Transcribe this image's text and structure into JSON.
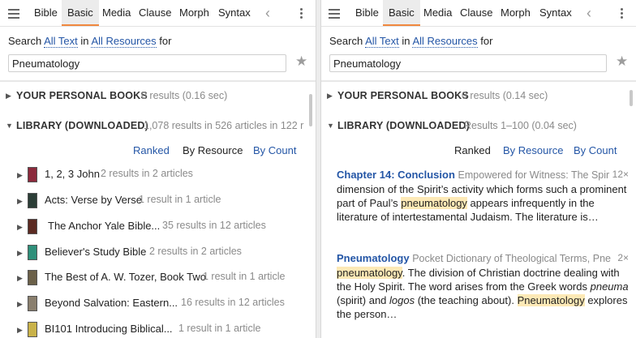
{
  "tabs": [
    "Bible",
    "Basic",
    "Media",
    "Clause",
    "Morph",
    "Syntax"
  ],
  "search_prefix": "Search",
  "search_scope": "All Text",
  "search_in": "in",
  "search_resources": "All Resources",
  "search_for": "for",
  "query": "Pneumatology",
  "left": {
    "personal": {
      "title": "YOUR PERSONAL BOOKS",
      "meta": "0 results (0.16 sec)"
    },
    "library": {
      "title": "LIBRARY (DOWNLOADED)",
      "meta": "1,078 results in 526 articles in 122 r"
    },
    "sort": {
      "ranked": "Ranked",
      "by_resource": "By Resource",
      "by_count": "By Count"
    },
    "books": [
      {
        "title": "1, 2, 3 John",
        "meta": "2 results in 2 articles",
        "cover": "#8b2a3c"
      },
      {
        "title": "Acts: Verse by Verse",
        "meta": "1 result in 1 article",
        "cover": "#2b3d36"
      },
      {
        "title": "The Anchor Yale Bible...",
        "meta": "35 results in 12 articles",
        "cover": "#5b2a22"
      },
      {
        "title": "Believer's Study Bible",
        "meta": "2 results in 2 articles",
        "cover": "#2f8f7a"
      },
      {
        "title": "The Best of A. W. Tozer, Book Two",
        "meta": "1 result in 1 article",
        "cover": "#6b6049"
      },
      {
        "title": "Beyond Salvation: Eastern...",
        "meta": "16 results in 12 articles",
        "cover": "#8a7f6e"
      },
      {
        "title": "BI101 Introducing Biblical...",
        "meta": "1 result in 1 article",
        "cover": "#c9b24a"
      }
    ]
  },
  "right": {
    "personal": {
      "title": "YOUR PERSONAL BOOKS",
      "meta": "0 results (0.14 sec)"
    },
    "library": {
      "title": "LIBRARY (DOWNLOADED)",
      "meta": "Results 1–100 (0.04 sec)"
    },
    "sort": {
      "ranked": "Ranked",
      "by_resource": "By Resource",
      "by_count": "By Count"
    },
    "results": [
      {
        "title": "Chapter 14: Conclusion",
        "source": "Empowered for Witness: The Spir",
        "count": "12×",
        "p1": "dimension of the Spirit’s activity which forms such a prominent part of Paul’s ",
        "hl1": "pneumatology",
        "p2": " appears infrequently in the literature of intertestamental Judaism. The literature is…"
      },
      {
        "title": "Pneumatology",
        "source": "Pocket Dictionary of Theological Terms, Pne",
        "count": "2×",
        "hl1": "pneumatology",
        "p1": ". The division of Christian doctrine dealing with the Holy Spirit. The word arises from the Greek words ",
        "i1": "pneuma",
        "p2": " (spirit) and ",
        "i2": "logos",
        "p3": " (the teaching about). ",
        "hl2": "Pneumatology",
        "p4": " explores the person…"
      }
    ]
  }
}
